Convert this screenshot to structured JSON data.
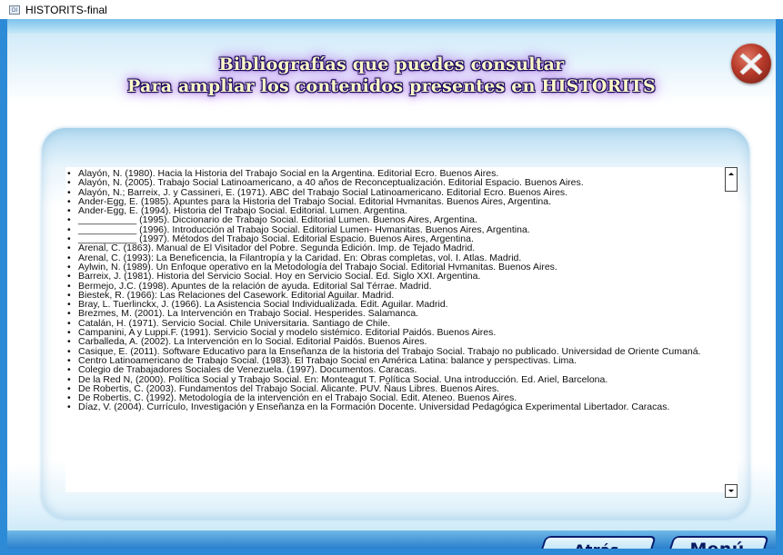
{
  "window": {
    "title": "HISTORITS-final",
    "icon_label": "DI"
  },
  "header": {
    "line1": "Bibliografías que puedes consultar",
    "line2": "Para ampliar los contenidos presentes en  HISTORITS"
  },
  "bullet": "•",
  "references": [
    "Alayón, N. (1980). Hacia la Historia del Trabajo Social en la Argentina. Editorial Ecro. Buenos Aires.",
    "Alayón, N. (2005). Trabajo Social Latinoamericano, a 40 años de Reconceptualización. Editorial Espacio. Buenos Aires.",
    "Alayón, N.; Barreix, J. y Cassineri, E. (1971). ABC del Trabajo Social Latinoamericano. Editorial Ecro. Buenos Aires.",
    "Ander-Egg, E. (1985). Apuntes para la Historia del Trabajo Social. Editorial Hvmanitas. Buenos Aires, Argentina.",
    "Ander-Egg, E.  (1994). Historia del Trabajo Social. Editorial. Lumen. Argentina.",
    "___________ (1995). Diccionario de Trabajo Social. Editorial Lumen. Buenos Aires, Argentina.",
    "___________ (1996). Introducción al Trabajo Social. Editorial Lumen- Hvmanitas. Buenos Aires, Argentina.",
    "___________ (1997). Métodos del Trabajo Social. Editorial Espacio. Buenos Aires, Argentina.",
    "Arenal, C. (1863). Manual de El Visitador del Pobre. Segunda Edición. Imp. de Tejado Madrid.",
    "Arenal, C. (1993): La Beneficencia, la Filantropía y la Caridad. En: Obras completas, vol. I. Atlas. Madrid.",
    "Aylwin, N. (1989). Un Enfoque operativo en la Metodología del Trabajo Social. Editorial Hvmanitas. Buenos Aires.",
    "Barreix, J. (1981). Historia del Servicio Social. Hoy en Servicio Social. Ed. Siglo XXI. Argentina.",
    "Bermejo, J.C. (1998). Apuntes de la relación de ayuda. Editorial Sal Térrae. Madrid.",
    "Biestek, R. (1966): Las Relaciones del Casework. Editorial Aguilar. Madrid.",
    "Bray, L. Tuerlinckx, J. (1966). La Asistencia Social Individualizada. Edit. Aguilar. Madrid.",
    "Brezmes, M. (2001). La Intervención en Trabajo Social. Hesperides. Salamanca.",
    "Catalán, H. (1971). Servicio Social. Chile Universitaria. Santiago de Chile.",
    "Campanini, A y Luppi.F. (1991). Servicio Social y modelo sistémico. Editorial Paidós. Buenos Aires.",
    "Carballeda, A. (2002). La Intervención en lo Social. Editorial Paidós. Buenos Aires.",
    "Casique, E. (2011). Software Educativo para la Enseñanza de la historia del Trabajo Social. Trabajo no publicado. Universidad de Oriente Cumaná.",
    "Centro Latinoamericano de Trabajo Social. (1983). El Trabajo Social en América Latina: balance y perspectivas. Lima.",
    "Colegio de Trabajadores Sociales de Venezuela. (1997). Documentos. Caracas.",
    "De la Red N, (2000). Política Social y Trabajo Social. En: Monteagut T.  Política Social. Una introducción. Ed. Ariel, Barcelona.",
    "De Robertis, C. (2003). Fundamentos del Trabajo Social. Alicante. PUV. Ñaus Libres. Buenos Aires.",
    "De Robertis, C. (1992). Metodología de la intervención en el Trabajo Social. Edit. Ateneo. Buenos Aires.",
    "Díaz, V. (2004).  Currículo, Investigación y Enseñanza en la Formación Docente. Universidad Pedagógica Experimental Libertador. Caracas."
  ],
  "buttons": {
    "back": "Atrás",
    "menu": "Menú"
  },
  "icons": {
    "close": "close-x-icon",
    "scroll_up": "scroll-up-arrow-icon",
    "scroll_down": "scroll-down-arrow-icon"
  },
  "colors": {
    "frame_blue": "#2d8ad6",
    "title_text": "#fff9c8",
    "title_glow": "#c66bf0",
    "button_text": "#0a1a60",
    "close_red": "#b83a2a"
  }
}
